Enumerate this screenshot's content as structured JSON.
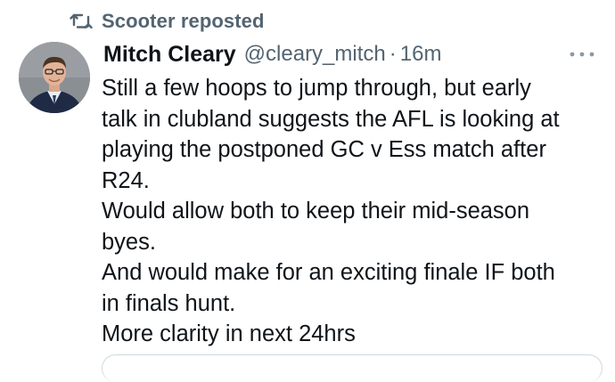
{
  "repost": {
    "icon": "repost-icon",
    "text": "Scooter reposted"
  },
  "author": {
    "display_name": "Mitch Cleary",
    "handle": "@cleary_mitch",
    "separator": "·",
    "time": "16m",
    "avatar": "avatar-photo"
  },
  "menu": {
    "icon": "more-horizontal-icon"
  },
  "tweet": {
    "lines": [
      "Still a few hoops to jump through, but early",
      "talk in clubland suggests the AFL is looking at",
      "playing the postponed GC v Ess match after",
      "R24.",
      "Would allow both to keep their mid-season",
      "byes.",
      "And would make for an exciting finale IF both",
      "in finals hunt.",
      "More clarity in next 24hrs"
    ]
  },
  "colors": {
    "text": "#0f1419",
    "secondary": "#536471",
    "border": "#cfd9de",
    "background": "#ffffff"
  }
}
